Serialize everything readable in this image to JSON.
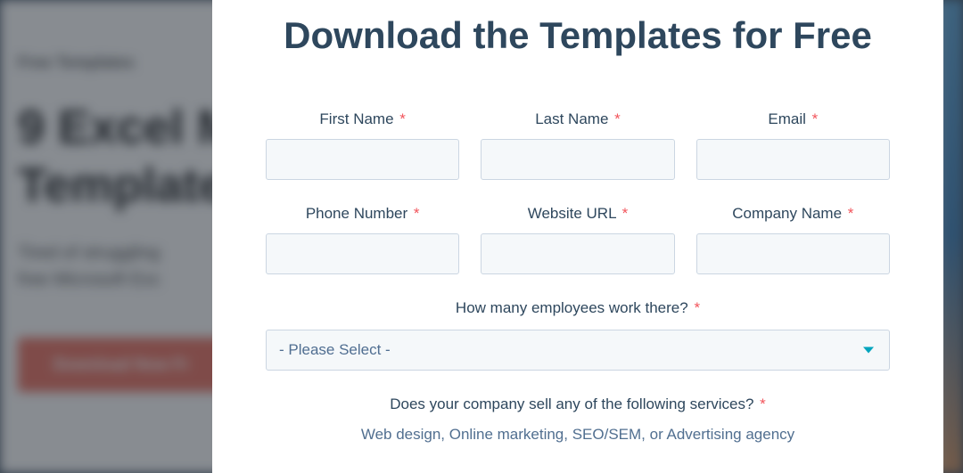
{
  "background": {
    "eyebrow": "Free Templates",
    "heading_line1": "9 Excel M",
    "heading_line2": "Template",
    "sub_line1": "Tired of struggling",
    "sub_line2": "free Microsoft Exc",
    "button": "Download Now Fr"
  },
  "modal": {
    "title": "Download the Templates for Free",
    "fields": {
      "first_name": {
        "label": "First Name"
      },
      "last_name": {
        "label": "Last Name"
      },
      "email": {
        "label": "Email"
      },
      "phone": {
        "label": "Phone Number"
      },
      "website": {
        "label": "Website URL"
      },
      "company": {
        "label": "Company Name"
      },
      "employees": {
        "label": "How many employees work there?",
        "placeholder": "- Please Select -"
      },
      "services": {
        "label": "Does your company sell any of the following services?",
        "sub": "Web design, Online marketing, SEO/SEM, or Advertising agency"
      }
    },
    "required_marker": "*"
  }
}
